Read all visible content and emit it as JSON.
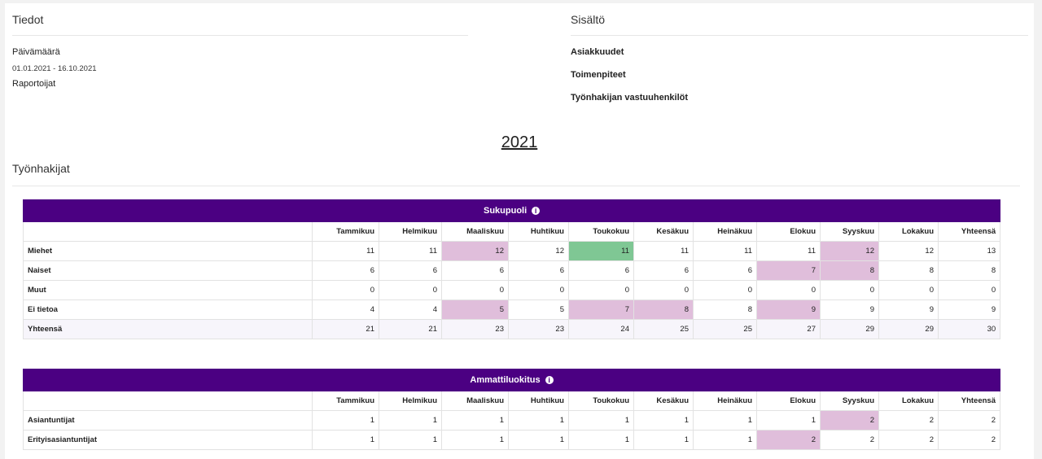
{
  "info": {
    "title": "Tiedot",
    "date_label": "Päivämäärä",
    "date_range": "01.01.2021 - 16.10.2021",
    "reporters_label": "Raportoijat"
  },
  "content": {
    "title": "Sisältö",
    "items": [
      "Asiakkuudet",
      "Toimenpiteet",
      "Työnhakijan vastuuhenkilöt"
    ]
  },
  "year": "2021",
  "section_title": "Työnhakijat",
  "months": [
    "Tammikuu",
    "Helmikuu",
    "Maaliskuu",
    "Huhtikuu",
    "Toukokuu",
    "Kesäkuu",
    "Heinäkuu",
    "Elokuu",
    "Syyskuu",
    "Lokakuu",
    "Yhteensä"
  ],
  "colors": {
    "header": "#4b0082",
    "increase": "#e0bedb",
    "decrease": "#7fc794"
  },
  "tables": [
    {
      "title": "Sukupuoli",
      "icon": "info-icon",
      "rows": [
        {
          "label": "Miehet",
          "values": [
            "11",
            "11",
            "12",
            "12",
            "11",
            "11",
            "11",
            "11",
            "12",
            "12",
            "13"
          ],
          "highlight": [
            "",
            "",
            "up",
            "",
            "down",
            "",
            "",
            "",
            "up",
            "",
            ""
          ]
        },
        {
          "label": "Naiset",
          "values": [
            "6",
            "6",
            "6",
            "6",
            "6",
            "6",
            "6",
            "7",
            "8",
            "8",
            "8"
          ],
          "highlight": [
            "",
            "",
            "",
            "",
            "",
            "",
            "",
            "up",
            "up",
            "",
            ""
          ]
        },
        {
          "label": "Muut",
          "values": [
            "0",
            "0",
            "0",
            "0",
            "0",
            "0",
            "0",
            "0",
            "0",
            "0",
            "0"
          ],
          "highlight": [
            "",
            "",
            "",
            "",
            "",
            "",
            "",
            "",
            "",
            "",
            ""
          ]
        },
        {
          "label": "Ei tietoa",
          "values": [
            "4",
            "4",
            "5",
            "5",
            "7",
            "8",
            "8",
            "9",
            "9",
            "9",
            "9"
          ],
          "highlight": [
            "",
            "",
            "up",
            "",
            "up",
            "up",
            "",
            "up",
            "",
            "",
            ""
          ]
        },
        {
          "label": "Yhteensä",
          "values": [
            "21",
            "21",
            "23",
            "23",
            "24",
            "25",
            "25",
            "27",
            "29",
            "29",
            "30"
          ],
          "highlight": [
            "",
            "",
            "",
            "",
            "",
            "",
            "",
            "",
            "",
            "",
            ""
          ],
          "total": true
        }
      ]
    },
    {
      "title": "Ammattiluokitus",
      "icon": "info-icon",
      "rows": [
        {
          "label": "Asiantuntijat",
          "values": [
            "1",
            "1",
            "1",
            "1",
            "1",
            "1",
            "1",
            "1",
            "2",
            "2",
            "2"
          ],
          "highlight": [
            "",
            "",
            "",
            "",
            "",
            "",
            "",
            "",
            "up",
            "",
            ""
          ]
        },
        {
          "label": "Erityisasiantuntijat",
          "values": [
            "1",
            "1",
            "1",
            "1",
            "1",
            "1",
            "1",
            "2",
            "2",
            "2",
            "2"
          ],
          "highlight": [
            "",
            "",
            "",
            "",
            "",
            "",
            "",
            "up",
            "",
            "",
            ""
          ]
        }
      ]
    }
  ]
}
